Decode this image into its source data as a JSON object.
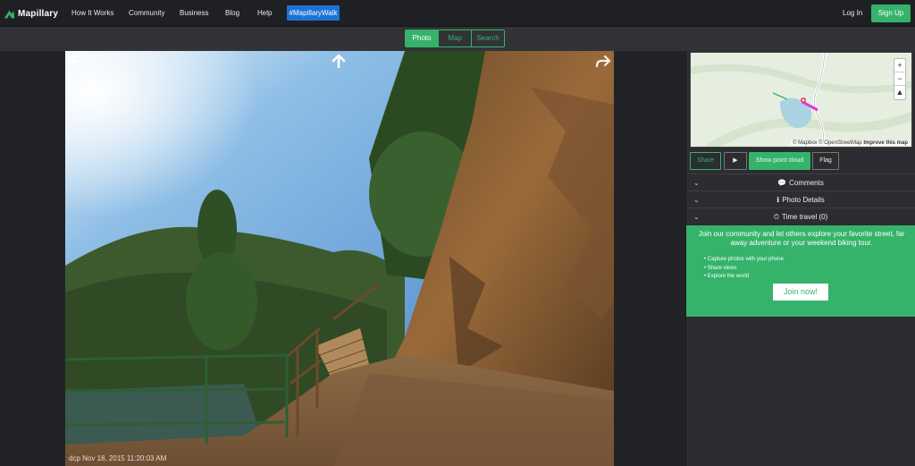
{
  "nav": {
    "brand": "Mapillary",
    "links": [
      "How It Works",
      "Community",
      "Business",
      "Blog",
      "Help"
    ],
    "badge": "#MapillaryWalk",
    "login": "Log In",
    "signup": "Sign Up"
  },
  "view_toggle": {
    "options": [
      "Photo",
      "Map",
      "Search"
    ],
    "selected": "Photo"
  },
  "photo": {
    "meta": "dcp  Nov 18, 2015 11:20:03 AM"
  },
  "map": {
    "zoom_in": "+",
    "zoom_out": "−",
    "compass": "▲",
    "attribution_prefix": "© Mapbox © OpenStreetMap",
    "attribution_link": "Improve this map"
  },
  "actions": {
    "share": "Share",
    "play": "▶",
    "point_cloud": "Show point cloud",
    "flag": "Flag"
  },
  "accordion": [
    {
      "label": "Comments",
      "icon": "comments-icon",
      "glyph": "💬"
    },
    {
      "label": "Photo Details",
      "icon": "info-icon",
      "glyph": "ℹ"
    },
    {
      "label": "Time travel (0)",
      "icon": "clock-icon",
      "glyph": "⏱"
    }
  ],
  "cta": {
    "title": "Join our community and let others explore your favorite street, far away adventure or your weekend biking tour.",
    "bullets": [
      "Capture photos with your phone",
      "Share views",
      "Explore the world"
    ],
    "button": "Join now!"
  },
  "colors": {
    "accent": "#36b36b",
    "badge": "#1d72d6",
    "nav_bg": "#1e2024"
  }
}
